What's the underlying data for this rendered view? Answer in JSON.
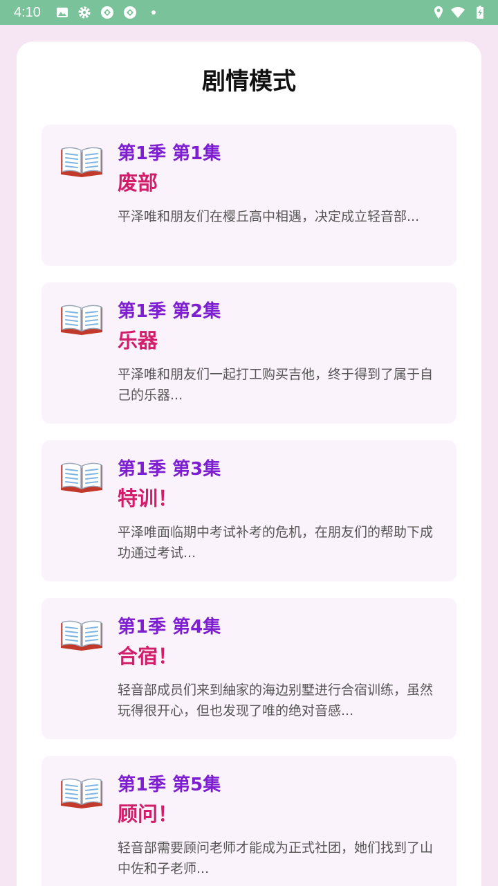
{
  "status_bar": {
    "time": "4:10",
    "left_icons": [
      "image-icon",
      "settings-gear-icon",
      "sync-icon",
      "sync-icon",
      "dot-icon"
    ],
    "right_icons": [
      "location-icon",
      "wifi-icon",
      "battery-charging-icon"
    ],
    "background_color": "#7ac29a"
  },
  "page": {
    "title": "剧情模式",
    "background_color": "#f6e6f4"
  },
  "episodes": [
    {
      "number": "第1季 第1集",
      "title": "废部",
      "description": "平泽唯和朋友们在樱丘高中相遇，决定成立轻音部...",
      "icon": "open-book-icon"
    },
    {
      "number": "第1季 第2集",
      "title": "乐器",
      "description": "平泽唯和朋友们一起打工购买吉他，终于得到了属于自己的乐器...",
      "icon": "open-book-icon"
    },
    {
      "number": "第1季 第3集",
      "title": "特训！",
      "description": "平泽唯面临期中考试补考的危机，在朋友们的帮助下成功通过考试...",
      "icon": "open-book-icon"
    },
    {
      "number": "第1季 第4集",
      "title": "合宿！",
      "description": "轻音部成员们来到紬家的海边别墅进行合宿训练，虽然玩得很开心，但也发现了唯的绝对音感...",
      "icon": "open-book-icon"
    },
    {
      "number": "第1季 第5集",
      "title": "顾问！",
      "description": "轻音部需要顾问老师才能成为正式社团，她们找到了山中佐和子老师...",
      "icon": "open-book-icon"
    }
  ],
  "colors": {
    "episode_number": "#7d1fd1",
    "episode_title": "#d21e6a",
    "card_background": "#fbf3fb"
  }
}
